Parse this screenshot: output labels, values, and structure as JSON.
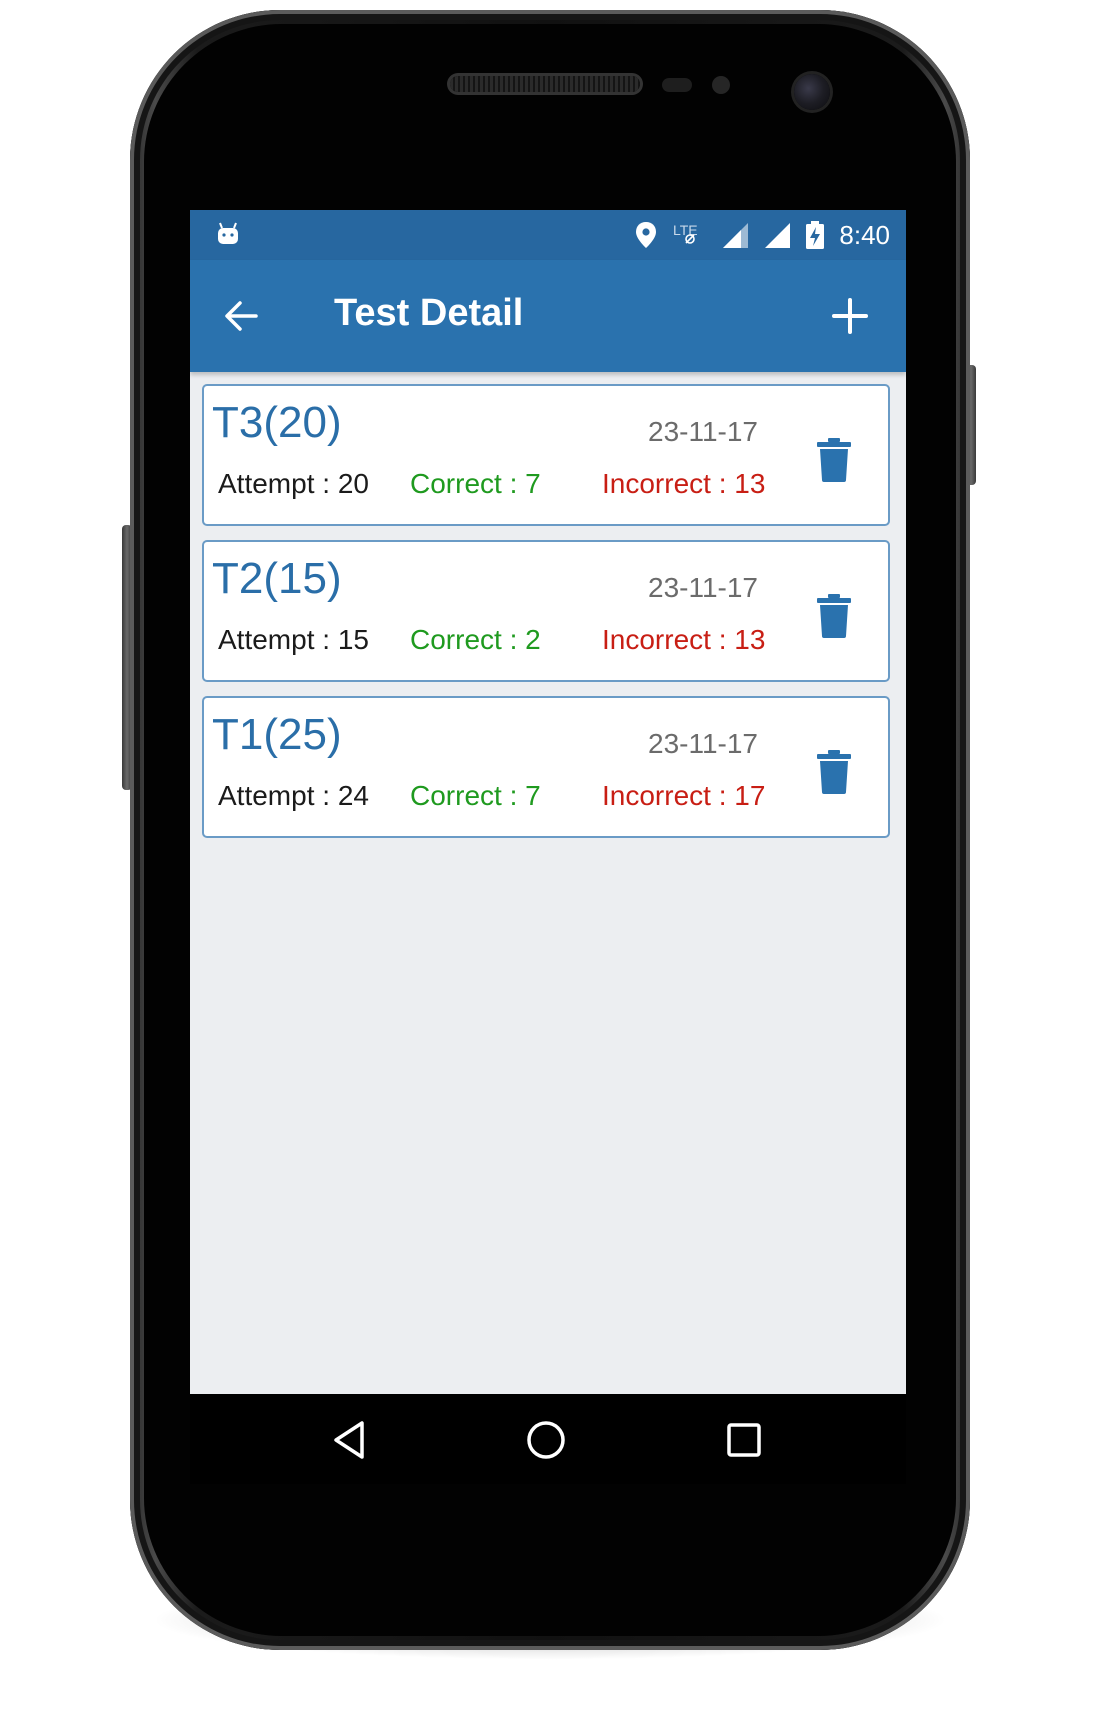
{
  "status_bar": {
    "time": "8:40",
    "network_label": "LTE"
  },
  "app_bar": {
    "title": "Test Detail"
  },
  "tests": [
    {
      "title": "T3(20)",
      "date": "23-11-17",
      "attempt": "Attempt : 20",
      "correct": "Correct : 7",
      "incorrect": "Incorrect : 13"
    },
    {
      "title": "T2(15)",
      "date": "23-11-17",
      "attempt": "Attempt : 15",
      "correct": "Correct : 2",
      "incorrect": "Incorrect : 13"
    },
    {
      "title": "T1(25)",
      "date": "23-11-17",
      "attempt": "Attempt : 24",
      "correct": "Correct : 7",
      "incorrect": "Incorrect : 17"
    }
  ],
  "colors": {
    "app_bar": "#2a72ae",
    "status_bar": "#2767a0",
    "title_blue": "#2a6ea8",
    "correct_green": "#1f9a1f",
    "incorrect_red": "#c81e14",
    "background": "#eceef1"
  },
  "icons": {
    "back": "arrow-left-icon",
    "add": "plus-icon",
    "delete": "trash-icon",
    "location": "location-pin-icon",
    "signal": "signal-icon",
    "battery": "battery-charging-icon",
    "notification": "android-icon",
    "nav_back": "triangle-back-icon",
    "nav_home": "circle-home-icon",
    "nav_recents": "square-recents-icon"
  }
}
